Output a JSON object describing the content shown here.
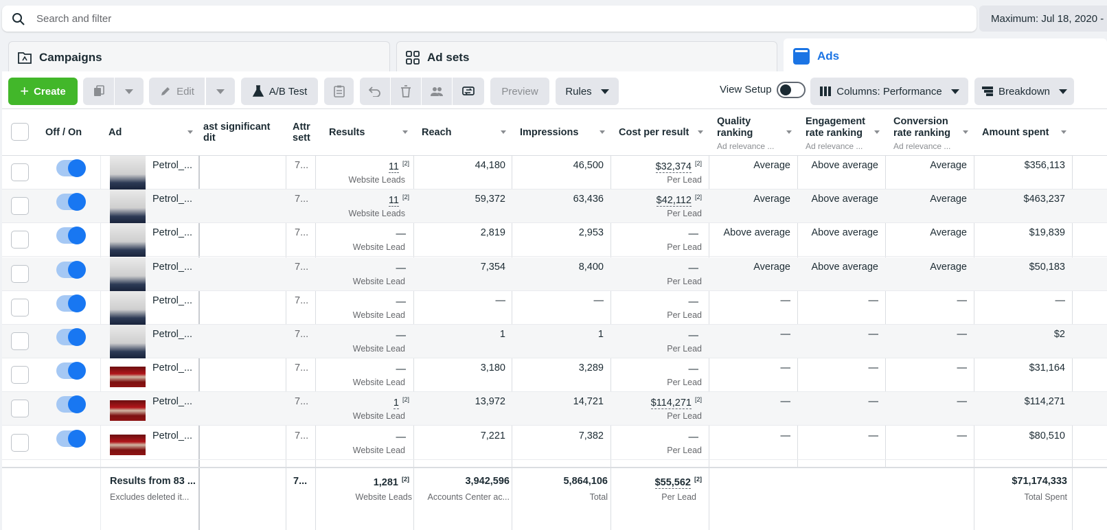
{
  "search": {
    "placeholder": "Search and filter"
  },
  "date_label": "Maximum: Jul 18, 2020 -",
  "tabs": {
    "campaigns": "Campaigns",
    "adsets": "Ad sets",
    "ads": "Ads"
  },
  "toolbar": {
    "create": "Create",
    "edit": "Edit",
    "ab_test": "A/B Test",
    "preview": "Preview",
    "rules": "Rules",
    "view_setup": "View Setup",
    "columns": "Columns: Performance",
    "breakdown": "Breakdown"
  },
  "columns": {
    "off_on": "Off / On",
    "ad": "Ad",
    "last_sig_1": "ast significant",
    "last_sig_2": "dit",
    "attr_1": "Attr",
    "attr_2": "sett",
    "results": "Results",
    "reach": "Reach",
    "impressions": "Impressions",
    "cost_per_result": "Cost per result",
    "quality_1": "Quality",
    "quality_2": "ranking",
    "quality_sub": "Ad relevance ...",
    "engagement_1": "Engagement",
    "engagement_2": "rate ranking",
    "engagement_sub": "Ad relevance ...",
    "conversion_1": "Conversion",
    "conversion_2": "rate ranking",
    "conversion_sub": "Ad relevance ...",
    "amount_spent": "Amount spent"
  },
  "rows": [
    {
      "name": "Petrol_...",
      "thumb": "a",
      "attr": "7...",
      "results": "11",
      "results_sup": "[2]",
      "results_sub": "Website Leads",
      "reach": "44,180",
      "impressions": "46,500",
      "cpr": "$32,374",
      "cpr_sup": "[2]",
      "cpr_sub": "Per Lead",
      "quality": "Average",
      "engagement": "Above average",
      "conversion": "Average",
      "spent": "$356,113"
    },
    {
      "name": "Petrol_...",
      "thumb": "a",
      "attr": "7...",
      "results": "11",
      "results_sup": "[2]",
      "results_sub": "Website Leads",
      "reach": "59,372",
      "impressions": "63,436",
      "cpr": "$42,112",
      "cpr_sup": "[2]",
      "cpr_sub": "Per Lead",
      "quality": "Average",
      "engagement": "Above average",
      "conversion": "Average",
      "spent": "$463,237"
    },
    {
      "name": "Petrol_...",
      "thumb": "a",
      "attr": "7...",
      "results": "—",
      "results_sup": "",
      "results_sub": "Website Lead",
      "reach": "2,819",
      "impressions": "2,953",
      "cpr": "—",
      "cpr_sup": "",
      "cpr_sub": "Per Lead",
      "quality": "Above average",
      "engagement": "Above average",
      "conversion": "Average",
      "spent": "$19,839"
    },
    {
      "name": "Petrol_...",
      "thumb": "a",
      "attr": "7...",
      "results": "—",
      "results_sup": "",
      "results_sub": "Website Lead",
      "reach": "7,354",
      "impressions": "8,400",
      "cpr": "—",
      "cpr_sup": "",
      "cpr_sub": "Per Lead",
      "quality": "Average",
      "engagement": "Above average",
      "conversion": "Average",
      "spent": "$50,183"
    },
    {
      "name": "Petrol_...",
      "thumb": "a",
      "attr": "7...",
      "results": "—",
      "results_sup": "",
      "results_sub": "Website Lead",
      "reach": "—",
      "impressions": "—",
      "cpr": "—",
      "cpr_sup": "",
      "cpr_sub": "Per Lead",
      "quality": "—",
      "engagement": "—",
      "conversion": "—",
      "spent": "—"
    },
    {
      "name": "Petrol_...",
      "thumb": "a",
      "attr": "7...",
      "results": "—",
      "results_sup": "",
      "results_sub": "Website Lead",
      "reach": "1",
      "impressions": "1",
      "cpr": "—",
      "cpr_sup": "",
      "cpr_sub": "Per Lead",
      "quality": "—",
      "engagement": "—",
      "conversion": "—",
      "spent": "$2"
    },
    {
      "name": "Petrol_...",
      "thumb": "b",
      "attr": "7...",
      "results": "—",
      "results_sup": "",
      "results_sub": "Website Lead",
      "reach": "3,180",
      "impressions": "3,289",
      "cpr": "—",
      "cpr_sup": "",
      "cpr_sub": "Per Lead",
      "quality": "—",
      "engagement": "—",
      "conversion": "—",
      "spent": "$31,164"
    },
    {
      "name": "Petrol_...",
      "thumb": "b",
      "attr": "7...",
      "results": "1",
      "results_sup": "[2]",
      "results_sub": "Website Lead",
      "reach": "13,972",
      "impressions": "14,721",
      "cpr": "$114,271",
      "cpr_sup": "[2]",
      "cpr_sub": "Per Lead",
      "quality": "—",
      "engagement": "—",
      "conversion": "—",
      "spent": "$114,271"
    },
    {
      "name": "Petrol_...",
      "thumb": "b",
      "attr": "7...",
      "results": "—",
      "results_sup": "",
      "results_sub": "Website Lead",
      "reach": "7,221",
      "impressions": "7,382",
      "cpr": "—",
      "cpr_sup": "",
      "cpr_sub": "Per Lead",
      "quality": "—",
      "engagement": "—",
      "conversion": "—",
      "spent": "$80,510"
    }
  ],
  "footer": {
    "title": "Results from 83 ...",
    "subtitle": "Excludes deleted it...",
    "attr": "7...",
    "results": "1,281",
    "results_sup": "[2]",
    "results_sub": "Website Leads",
    "reach": "3,942,596",
    "reach_sub": "Accounts Center ac...",
    "impressions": "5,864,106",
    "impressions_sub": "Total",
    "cpr": "$55,562",
    "cpr_sup": "[2]",
    "cpr_sub": "Per Lead",
    "spent": "$71,174,333",
    "spent_sub": "Total Spent"
  },
  "colors": {
    "accent": "#1877f2",
    "create": "#42b72a",
    "tab_active": "#1b74e4"
  }
}
